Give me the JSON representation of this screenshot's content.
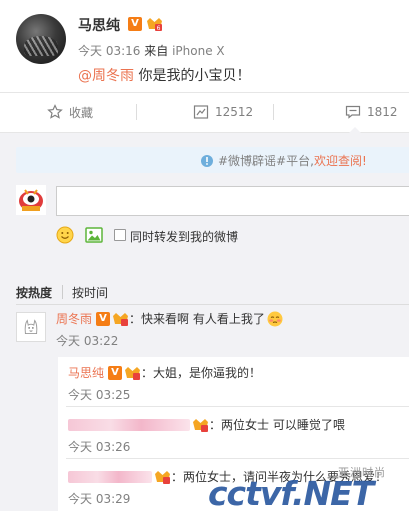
{
  "post": {
    "author": "马思纯",
    "time": "今天 03:16",
    "from_label": "来自",
    "device": "iPhone X",
    "mention": "@周冬雨",
    "text": " 你是我的小宝贝！"
  },
  "actions": {
    "favorite_label": "收藏",
    "repost_count": "12512",
    "comment_count": "1812"
  },
  "notice": {
    "text": "#微博辟谣#平台,",
    "link": "欢迎查阅!"
  },
  "compose": {
    "placeholder": "",
    "emoji_icon": "emoji-icon",
    "image_icon": "image-icon",
    "checkbox_label": "同时转发到我的微博",
    "checkbox_checked": false
  },
  "sort": {
    "hot_label": "按热度",
    "time_label": "按时间",
    "active": "hot"
  },
  "comments": [
    {
      "author": "周冬雨",
      "text": "：快来看啊 有人看上我了",
      "emoji": "embarrassed-emoji",
      "time": "今天 03:22",
      "replies": [
        {
          "author": "马思纯",
          "text": "：大姐，是你逼我的！",
          "time": "今天 03:25"
        },
        {
          "author": "",
          "text": "：两位女士 可以睡觉了喂",
          "time": "今天 03:26"
        },
        {
          "author": "",
          "text": "：两位女士，请问半夜为什么要秀恩爱！",
          "time": "今天 03:29"
        }
      ]
    }
  ],
  "colors": {
    "accent": "#eb7350",
    "vip": "#f57d15",
    "background": "#f2f2f5",
    "notice_bg": "#eaf3fb"
  },
  "watermark": {
    "main": "cctvf.NET",
    "sub": "亚洲时尚"
  }
}
